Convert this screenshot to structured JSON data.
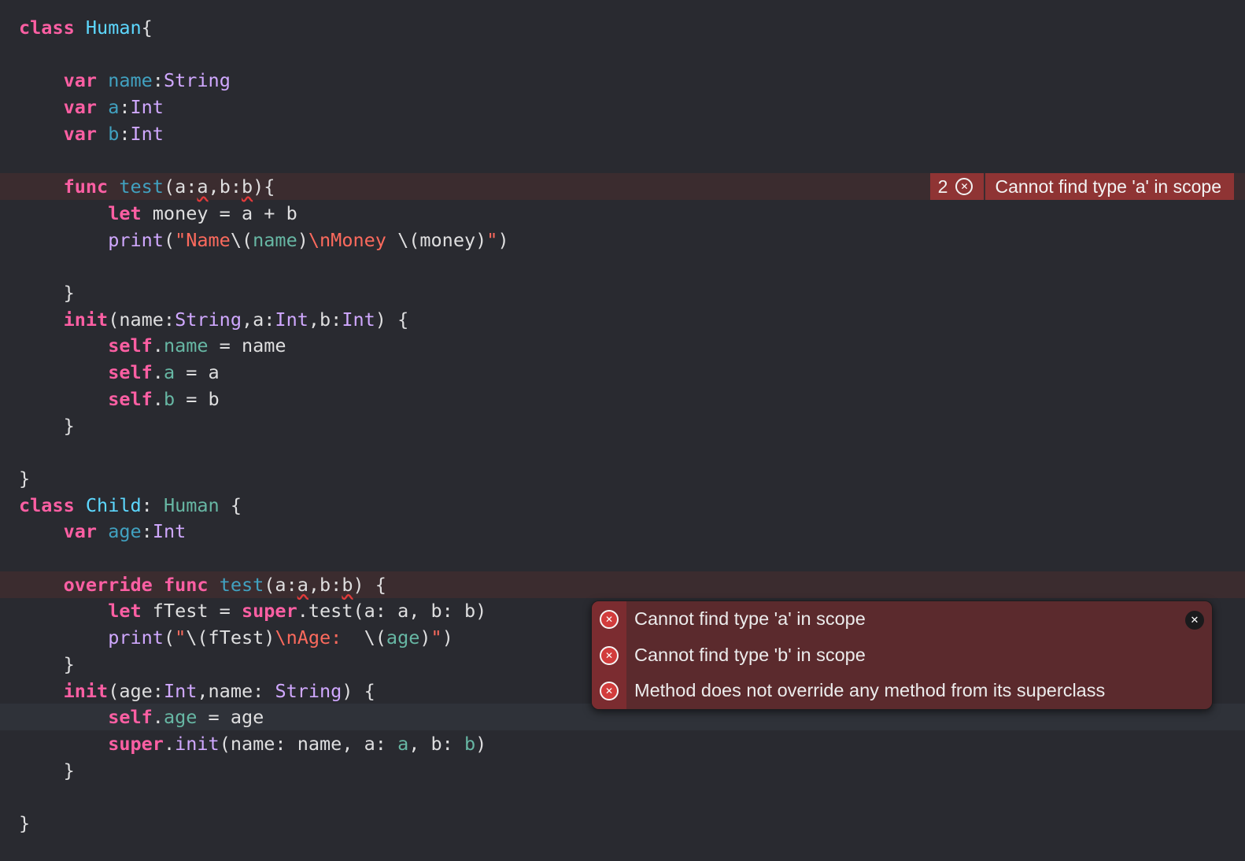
{
  "lines": [
    [
      [
        "kw",
        "class"
      ],
      [
        "pl",
        " "
      ],
      [
        "cls",
        "Human"
      ],
      [
        "pl",
        "{"
      ]
    ],
    [],
    [
      [
        "pl",
        "    "
      ],
      [
        "kw",
        "var"
      ],
      [
        "pl",
        " "
      ],
      [
        "fnd",
        "name"
      ],
      [
        "pl",
        ":"
      ],
      [
        "typ",
        "String"
      ]
    ],
    [
      [
        "pl",
        "    "
      ],
      [
        "kw",
        "var"
      ],
      [
        "pl",
        " "
      ],
      [
        "fnd",
        "a"
      ],
      [
        "pl",
        ":"
      ],
      [
        "typ",
        "Int"
      ]
    ],
    [
      [
        "pl",
        "    "
      ],
      [
        "kw",
        "var"
      ],
      [
        "pl",
        " "
      ],
      [
        "fnd",
        "b"
      ],
      [
        "pl",
        ":"
      ],
      [
        "typ",
        "Int"
      ]
    ],
    [],
    [
      [
        "pl",
        "    "
      ],
      [
        "kw",
        "func"
      ],
      [
        "pl",
        " "
      ],
      [
        "fnd",
        "test"
      ],
      [
        "pl",
        "(a:"
      ],
      [
        "u",
        "a"
      ],
      [
        "pl",
        ",b:"
      ],
      [
        "u",
        "b"
      ],
      [
        "pl",
        "){"
      ]
    ],
    [
      [
        "pl",
        "        "
      ],
      [
        "kw",
        "let"
      ],
      [
        "pl",
        " money = a + b"
      ]
    ],
    [
      [
        "pl",
        "        "
      ],
      [
        "typ",
        "print"
      ],
      [
        "pl",
        "("
      ],
      [
        "str",
        "\"Name"
      ],
      [
        "pl",
        "\\("
      ],
      [
        "ref",
        "name"
      ],
      [
        "pl",
        ")"
      ],
      [
        "str",
        "\\nMoney"
      ],
      [
        "pl",
        " \\(money)"
      ],
      [
        "str",
        "\""
      ],
      [
        "pl",
        ")"
      ]
    ],
    [],
    [
      [
        "pl",
        "    }"
      ]
    ],
    [
      [
        "pl",
        "    "
      ],
      [
        "kw",
        "init"
      ],
      [
        "pl",
        "(name:"
      ],
      [
        "typ",
        "String"
      ],
      [
        "pl",
        ",a:"
      ],
      [
        "typ",
        "Int"
      ],
      [
        "pl",
        ",b:"
      ],
      [
        "typ",
        "Int"
      ],
      [
        "pl",
        ") {"
      ]
    ],
    [
      [
        "pl",
        "        "
      ],
      [
        "kw",
        "self"
      ],
      [
        "pl",
        "."
      ],
      [
        "ref",
        "name"
      ],
      [
        "pl",
        " = name"
      ]
    ],
    [
      [
        "pl",
        "        "
      ],
      [
        "kw",
        "self"
      ],
      [
        "pl",
        "."
      ],
      [
        "ref",
        "a"
      ],
      [
        "pl",
        " = a"
      ]
    ],
    [
      [
        "pl",
        "        "
      ],
      [
        "kw",
        "self"
      ],
      [
        "pl",
        "."
      ],
      [
        "ref",
        "b"
      ],
      [
        "pl",
        " = b"
      ]
    ],
    [
      [
        "pl",
        "    }"
      ]
    ],
    [],
    [
      [
        "pl",
        "}"
      ]
    ],
    [
      [
        "kw",
        "class"
      ],
      [
        "pl",
        " "
      ],
      [
        "cls",
        "Child"
      ],
      [
        "pl",
        ": "
      ],
      [
        "ref",
        "Human"
      ],
      [
        "pl",
        " {"
      ]
    ],
    [
      [
        "pl",
        "    "
      ],
      [
        "kw",
        "var"
      ],
      [
        "pl",
        " "
      ],
      [
        "fnd",
        "age"
      ],
      [
        "pl",
        ":"
      ],
      [
        "typ",
        "Int"
      ]
    ],
    [],
    [
      [
        "pl",
        "    "
      ],
      [
        "kw",
        "override"
      ],
      [
        "pl",
        " "
      ],
      [
        "kw",
        "func"
      ],
      [
        "pl",
        " "
      ],
      [
        "fnd",
        "test"
      ],
      [
        "pl",
        "(a:"
      ],
      [
        "u",
        "a"
      ],
      [
        "pl",
        ",b:"
      ],
      [
        "u",
        "b"
      ],
      [
        "pl",
        ") {"
      ]
    ],
    [
      [
        "pl",
        "        "
      ],
      [
        "kw",
        "let"
      ],
      [
        "pl",
        " fTest = "
      ],
      [
        "kw",
        "super"
      ],
      [
        "pl",
        ".test(a: a, b: b)"
      ]
    ],
    [
      [
        "pl",
        "        "
      ],
      [
        "typ",
        "print"
      ],
      [
        "pl",
        "("
      ],
      [
        "str",
        "\""
      ],
      [
        "pl",
        "\\(fTest)"
      ],
      [
        "str",
        "\\nAge:  "
      ],
      [
        "pl",
        "\\("
      ],
      [
        "ref",
        "age"
      ],
      [
        "pl",
        ")"
      ],
      [
        "str",
        "\""
      ],
      [
        "pl",
        ")"
      ]
    ],
    [
      [
        "pl",
        "    }"
      ]
    ],
    [
      [
        "pl",
        "    "
      ],
      [
        "kw",
        "init"
      ],
      [
        "pl",
        "(age:"
      ],
      [
        "typ",
        "Int"
      ],
      [
        "pl",
        ",name: "
      ],
      [
        "typ",
        "String"
      ],
      [
        "pl",
        ") {"
      ]
    ],
    [
      [
        "pl",
        "        "
      ],
      [
        "kw",
        "self"
      ],
      [
        "pl",
        "."
      ],
      [
        "ref",
        "age"
      ],
      [
        "pl",
        " = age"
      ]
    ],
    [
      [
        "pl",
        "        "
      ],
      [
        "kw",
        "super"
      ],
      [
        "pl",
        "."
      ],
      [
        "typ",
        "init"
      ],
      [
        "pl",
        "(name: name, a: "
      ],
      [
        "ref",
        "a"
      ],
      [
        "pl",
        ", b: "
      ],
      [
        "ref",
        "b"
      ],
      [
        "pl",
        ")"
      ]
    ],
    [
      [
        "pl",
        "    }"
      ]
    ],
    [],
    [
      [
        "pl",
        "}"
      ]
    ]
  ],
  "inline_error": {
    "count": "2",
    "message": "Cannot find type 'a' in scope"
  },
  "popup": {
    "messages": [
      "Cannot find type 'a' in scope",
      "Cannot find type 'b' in scope",
      "Method does not override any method from its superclass"
    ]
  },
  "colors": {
    "background": "#292a30",
    "keyword": "#fc5fa3",
    "type": "#d0a8ff",
    "error": "#8f3434"
  }
}
